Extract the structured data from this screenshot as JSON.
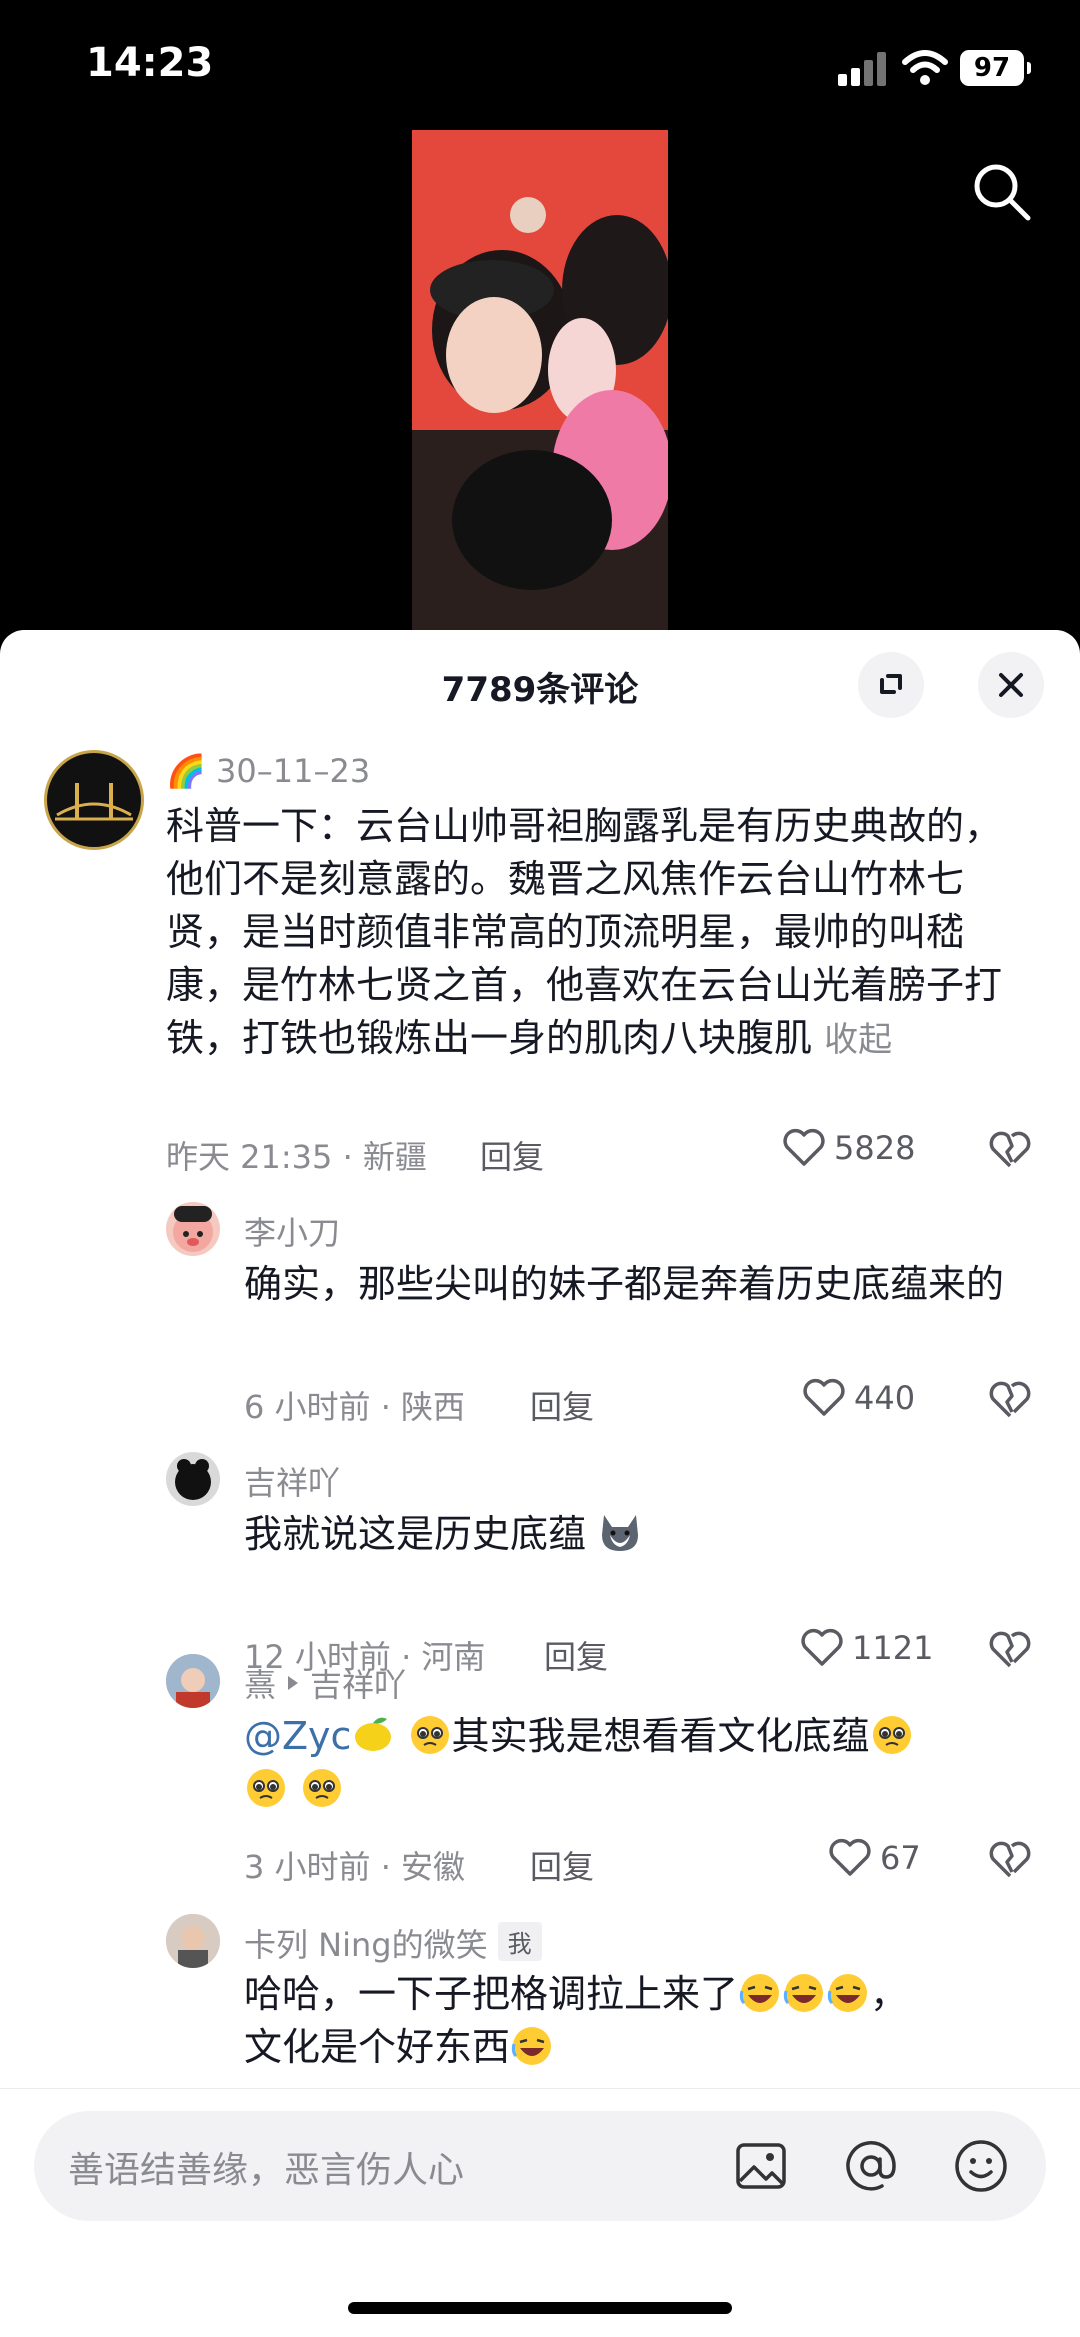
{
  "status_bar": {
    "time": "14:23",
    "battery": "97"
  },
  "sheet": {
    "title": "7789条评论",
    "comments": [
      {
        "user": "🌈 30–11–23",
        "text": "科普一下：云台山帅哥袒胸露乳是有历史典故的，他们不是刻意露的。魏晋之风焦作云台山竹林七贤，是当时颜值非常高的顶流明星，最帅的叫嵇康，是竹林七贤之首，他喜欢在云台山光着膀子打铁，打铁也锻炼出一身的肌肉八块腹肌",
        "collapse": "收起",
        "time_loc": "昨天 21:35 · 新疆",
        "reply": "回复",
        "likes": "5828"
      },
      {
        "user": "李小刀",
        "text": "确实，那些尖叫的妹子都是奔着历史底蕴来的",
        "time_loc": "6 小时前 · 陕西",
        "reply": "回复",
        "likes": "440"
      },
      {
        "user": "吉祥吖",
        "text": "我就说这是历史底蕴",
        "time_loc": "12 小时前 · 河南",
        "reply": "回复",
        "likes": "1121"
      },
      {
        "user": "熹",
        "reply_to": "吉祥吖",
        "mention": "@Zyc",
        "text": "其实我是想看看文化底蕴",
        "time_loc": "3 小时前 · 安徽",
        "reply": "回复",
        "likes": "67"
      },
      {
        "user": "卡列 Ning的微笑",
        "badge": "我",
        "text_line1": "哈哈，一下子把格调拉上来了",
        "text_line1_end": "，",
        "text_line2": "文化是个好东西"
      }
    ]
  },
  "input": {
    "placeholder": "善语结善缘，恶言伤人心"
  },
  "icons": [
    "search-icon",
    "expand-icon",
    "close-icon",
    "heart-icon",
    "dislike-icon",
    "image-icon",
    "at-icon",
    "emoji-icon"
  ],
  "colors": {
    "accent_link": "#3d6fa8",
    "video_bg": "#e74b3e"
  }
}
